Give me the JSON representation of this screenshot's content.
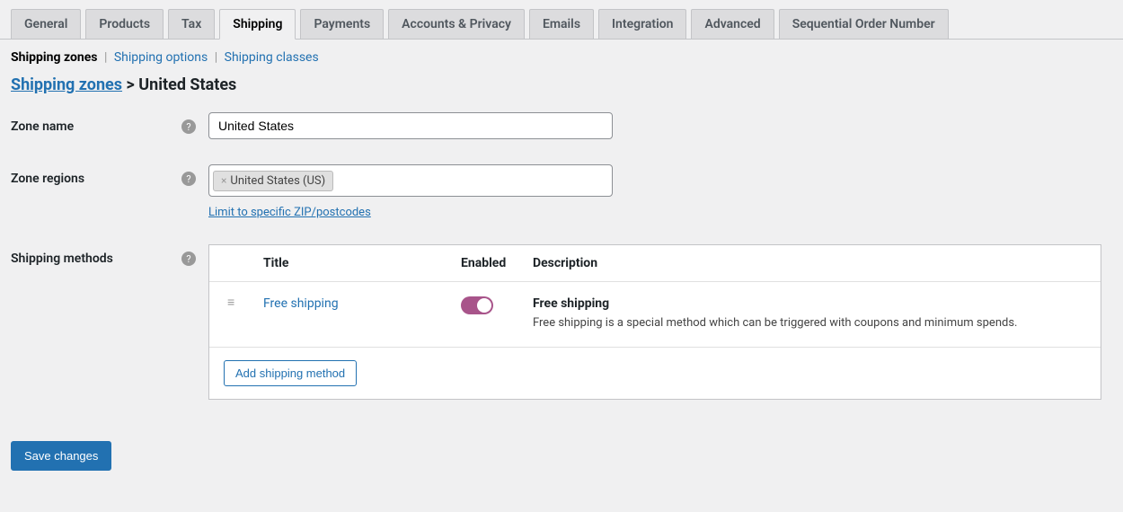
{
  "tabs": [
    "General",
    "Products",
    "Tax",
    "Shipping",
    "Payments",
    "Accounts & Privacy",
    "Emails",
    "Integration",
    "Advanced",
    "Sequential Order Number"
  ],
  "active_tab_index": 3,
  "subnav": {
    "zones": "Shipping zones",
    "options": "Shipping options",
    "classes": "Shipping classes"
  },
  "breadcrumb": {
    "parent": "Shipping zones",
    "separator": ">",
    "current": "United States"
  },
  "form": {
    "zone_name_label": "Zone name",
    "zone_name_value": "United States",
    "zone_regions_label": "Zone regions",
    "zone_region_tag": "United States (US)",
    "zip_link": "Limit to specific ZIP/postcodes",
    "methods_label": "Shipping methods"
  },
  "methods_table": {
    "headers": {
      "title": "Title",
      "enabled": "Enabled",
      "description": "Description"
    },
    "rows": [
      {
        "title": "Free shipping",
        "enabled": true,
        "desc_title": "Free shipping",
        "desc_text": "Free shipping is a special method which can be triggered with coupons and minimum spends."
      }
    ],
    "add_button": "Add shipping method"
  },
  "save_button": "Save changes"
}
